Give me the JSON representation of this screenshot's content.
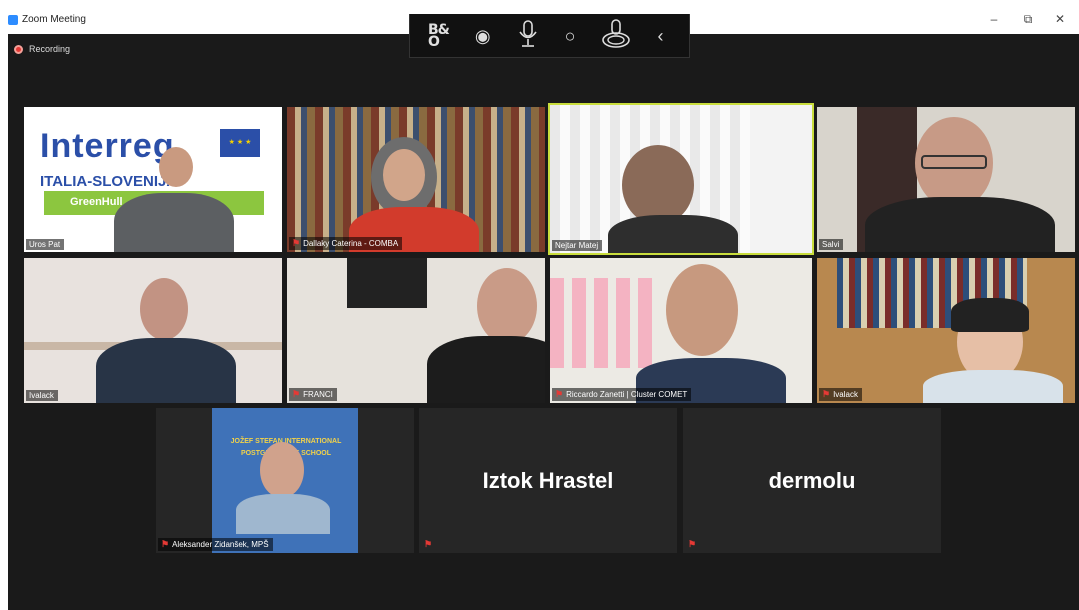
{
  "window": {
    "title": "Zoom Meeting",
    "controls": [
      "–",
      "⧉",
      "✕"
    ]
  },
  "recording": {
    "label": "Recording"
  },
  "toolbar": {
    "brand": "B&O"
  },
  "participants": [
    {
      "name": "Uros Pat",
      "logo_text": "Interreg",
      "program": "ITALIA-SLOVENIJA",
      "project": "GreenHull"
    },
    {
      "name": "Dallaky Caterina - COMBA"
    },
    {
      "name": "Nejtar Matej"
    },
    {
      "name": "Salvi"
    },
    {
      "name": "Ivalack"
    },
    {
      "name": "FRANCI"
    },
    {
      "name": "Riccardo Zanetti | Cluster COMET"
    },
    {
      "name": "Ivalack"
    },
    {
      "name": "Aleksander Zidanšek, MPŠ",
      "banner": "JOŽEF STEFAN INTERNATIONAL POSTGRADUATE SCHOOL"
    },
    {
      "name": "Iztok Hrastel"
    },
    {
      "name": "dermolu"
    }
  ]
}
